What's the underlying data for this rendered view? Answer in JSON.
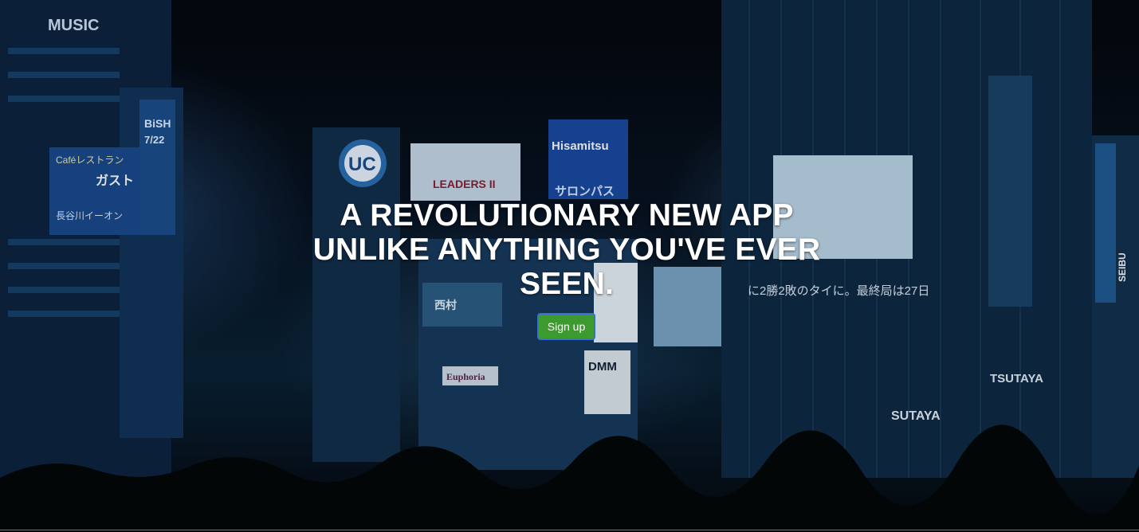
{
  "hero": {
    "headline": "A REVOLUTIONARY NEW APP UNLIKE ANYTHING YOU'VE EVER SEEN.",
    "signup_label": "Sign up",
    "signup_color": "#3d9a2f",
    "signup_border_color": "#3b6fd6"
  },
  "backdrop_signs": {
    "music": "MUSIC",
    "uc": "UC",
    "leaders": "LEADERS II",
    "hisamitsu": "Hisamitsu",
    "salonpas": "サロンパス",
    "bish": "BiSH",
    "bish_date": "7/22",
    "cafe": "Caféレストラン",
    "gust": "ガスト",
    "aeon": "長谷川イーオン",
    "euphoria": "Euphoria",
    "dmm": "DMM",
    "tsutaya_1": "TSUTAYA",
    "tsutaya_2": "SUTAYA",
    "seibu": "SEIBU",
    "broadcast": "に2勝2敗のタイに。最終局は27日",
    "nishimura": "西村"
  }
}
